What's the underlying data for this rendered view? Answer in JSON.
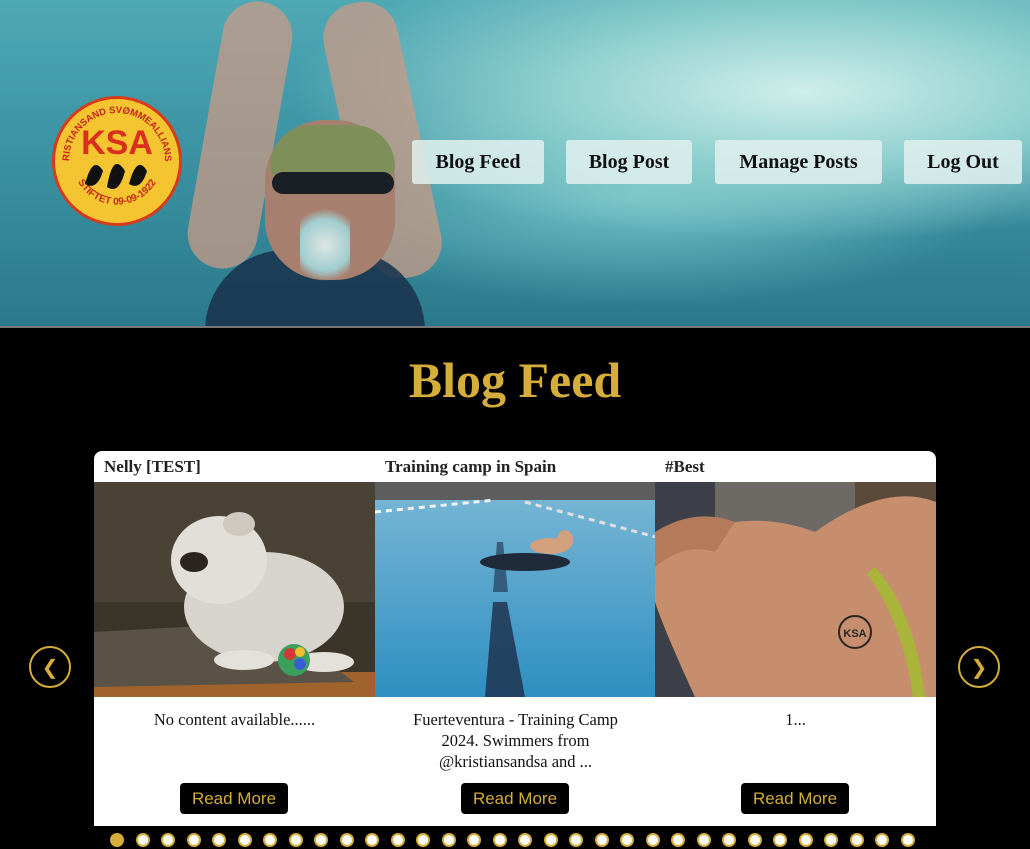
{
  "logo": {
    "top_text": "KRISTIANSAND SVØMMEALLIANSE",
    "initials": "KSA",
    "bottom_text": "STIFTET 09-09-1922"
  },
  "nav": {
    "items": [
      {
        "label": "Blog Feed"
      },
      {
        "label": "Blog Post"
      },
      {
        "label": "Manage Posts"
      },
      {
        "label": "Log Out"
      }
    ]
  },
  "page": {
    "title": "Blog Feed"
  },
  "carousel": {
    "prev_label": "❮",
    "next_label": "❯",
    "cards": [
      {
        "title": "Nelly [TEST]",
        "text": "No content available......",
        "button": "Read More",
        "image": "bulldog-photo"
      },
      {
        "title": "Training camp in Spain",
        "text": "Fuerteventura - Training Camp 2024. Swimmers from @kristiansandsa and ...",
        "button": "Read More",
        "image": "pool-swimmer-photo"
      },
      {
        "title": "#Best",
        "text": "1...",
        "button": "Read More",
        "image": "shoulder-tattoo-photo"
      }
    ],
    "dots_count": 32,
    "active_dot": 0
  },
  "colors": {
    "accent": "#d4ad3a",
    "background": "#000000",
    "card": "#ffffff"
  }
}
